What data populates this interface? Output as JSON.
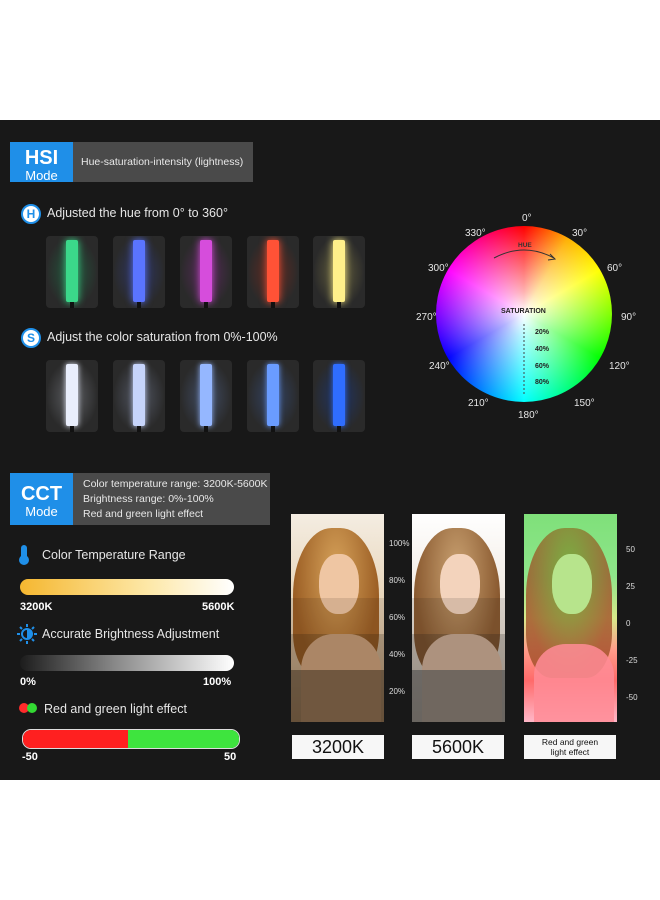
{
  "hsi": {
    "badge_big": "HSI",
    "badge_small": "Mode",
    "description": "Hue-saturation-intensity (lightness)",
    "hue_letter": "H",
    "hue_label": "Adjusted the hue from 0° to 360°",
    "sat_letter": "S",
    "sat_label": "Adjust the color saturation from 0%-100%",
    "hue_tube_colors": [
      "#3bd88a",
      "#5a74ff",
      "#d64ddc",
      "#ff5236",
      "#fff08a"
    ],
    "sat_tube_colors": [
      "#e9eefc",
      "#c6d4fb",
      "#95b7ff",
      "#6a9cff",
      "#2f6dff"
    ],
    "wheel": {
      "hue_title": "HUE",
      "saturation_title": "SATURATION",
      "angles": [
        "0°",
        "30°",
        "60°",
        "90°",
        "120°",
        "150°",
        "180°",
        "210°",
        "240°",
        "270°",
        "300°",
        "330°"
      ],
      "saturation_steps": [
        "20%",
        "40%",
        "60%",
        "80%"
      ]
    }
  },
  "cct": {
    "badge_big": "CCT",
    "badge_small": "Mode",
    "desc_lines": [
      "Color temperature range: 3200K-5600K",
      "Brightness range: 0%-100%",
      "Red and green light effect"
    ],
    "temp": {
      "title": "Color Temperature Range",
      "min_label": "3200K",
      "max_label": "5600K"
    },
    "brightness": {
      "title": "Accurate Brightness Adjustment",
      "min_label": "0%",
      "max_label": "100%"
    },
    "redgreen": {
      "title": "Red and green  light effect",
      "min_label": "-50",
      "max_label": "50"
    },
    "brightness_scale": [
      "100%",
      "80%",
      "60%",
      "40%",
      "20%"
    ],
    "rg_scale": [
      "50",
      "25",
      "0",
      "-25",
      "-50"
    ],
    "photos": [
      {
        "label": "3200K"
      },
      {
        "label": "5600K"
      },
      {
        "label_line1": "Red and green",
        "label_line2": "light effect"
      }
    ]
  }
}
